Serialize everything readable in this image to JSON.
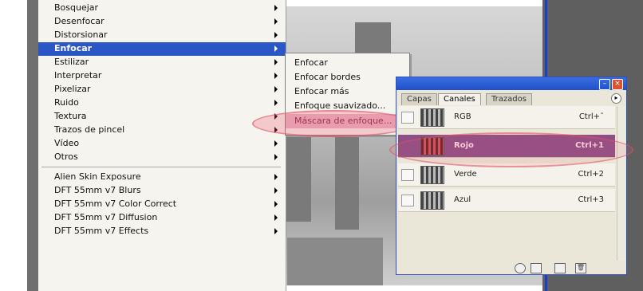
{
  "filter_menu": {
    "items": [
      {
        "label": "Bosquejar"
      },
      {
        "label": "Desenfocar"
      },
      {
        "label": "Distorsionar"
      },
      {
        "label": "Enfocar"
      },
      {
        "label": "Estilizar"
      },
      {
        "label": "Interpretar"
      },
      {
        "label": "Pixelizar"
      },
      {
        "label": "Ruido"
      },
      {
        "label": "Textura"
      },
      {
        "label": "Trazos de pincel"
      },
      {
        "label": "Vídeo"
      },
      {
        "label": "Otros"
      }
    ],
    "plugins": [
      {
        "label": "Alien Skin Exposure"
      },
      {
        "label": "DFT 55mm v7 Blurs"
      },
      {
        "label": "DFT 55mm v7 Color Correct"
      },
      {
        "label": "DFT 55mm v7 Diffusion"
      },
      {
        "label": "DFT 55mm v7 Effects"
      }
    ],
    "selected": "Enfocar"
  },
  "enfocar_submenu": {
    "items": [
      {
        "label": "Enfocar"
      },
      {
        "label": "Enfocar bordes"
      },
      {
        "label": "Enfocar más"
      },
      {
        "label": "Enfoque suavizado..."
      },
      {
        "label": "Máscara de enfoque..."
      }
    ],
    "highlighted": "Máscara de enfoque..."
  },
  "channels_panel": {
    "tabs": [
      "Capas",
      "Canales",
      "Trazados"
    ],
    "active_tab": "Canales",
    "channels": [
      {
        "name": "RGB",
        "shortcut": "Ctrl+˜"
      },
      {
        "name": "Rojo",
        "shortcut": "Ctrl+1"
      },
      {
        "name": "Verde",
        "shortcut": "Ctrl+2"
      },
      {
        "name": "Azul",
        "shortcut": "Ctrl+3"
      }
    ],
    "highlighted_channel": "Rojo",
    "title_buttons": [
      "minimize-icon",
      "close-icon"
    ],
    "bottom_icons": [
      "load-selection-icon",
      "save-selection-icon",
      "new-channel-icon",
      "delete-icon"
    ]
  },
  "colors": {
    "menu_selection": "#2b56c6",
    "annotation_highlight": "#e6b6c6",
    "channel_highlight": "#8d4f86",
    "panel_title": "#2050c8"
  }
}
